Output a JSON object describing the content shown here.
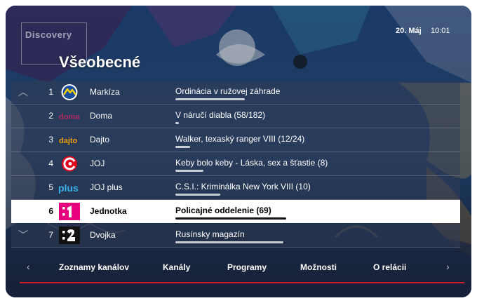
{
  "header": {
    "watermark": "Discovery",
    "date": "20. Máj",
    "time": "10:01",
    "title": "Všeobecné"
  },
  "channels": [
    {
      "num": "1",
      "name": "Markíza",
      "program": "Ordinácia v ružovej záhrade",
      "progress": 0.62,
      "logo": "markiza-logo",
      "selected": false
    },
    {
      "num": "2",
      "name": "Doma",
      "program": "V náručí diabla (58/182)",
      "progress": 0.03,
      "logo": "doma-logo",
      "selected": false
    },
    {
      "num": "3",
      "name": "Dajto",
      "program": "Walker, texaský ranger VIII (12/24)",
      "progress": 0.13,
      "logo": "dajto-logo",
      "selected": false
    },
    {
      "num": "4",
      "name": "JOJ",
      "program": "Keby bolo keby - Láska, sex a šťastie (8)",
      "progress": 0.25,
      "logo": "joj-logo",
      "selected": false
    },
    {
      "num": "5",
      "name": "JOJ plus",
      "program": "C.S.I.: Kriminálka New York VIII (10)",
      "progress": 0.4,
      "logo": "jojplus-logo",
      "selected": false
    },
    {
      "num": "6",
      "name": "Jednotka",
      "program": "Policajné oddelenie (69)",
      "progress": 0.99,
      "logo": "jednotka-logo",
      "selected": true
    },
    {
      "num": "7",
      "name": "Dvojka",
      "program": "Rusínsky magazín",
      "progress": 0.96,
      "logo": "dvojka-logo",
      "selected": false
    }
  ],
  "list_arrows": {
    "up": "︿",
    "down": "﹀"
  },
  "menu": {
    "left_arrow": "‹",
    "right_arrow": "›",
    "items": [
      "Zoznamy kanálov",
      "Kanály",
      "Programy",
      "Možnosti",
      "O relácii"
    ]
  },
  "colors": {
    "accent": "#d11a2a",
    "selected_row": "#ffffff",
    "jednotka": "#e6007e"
  }
}
